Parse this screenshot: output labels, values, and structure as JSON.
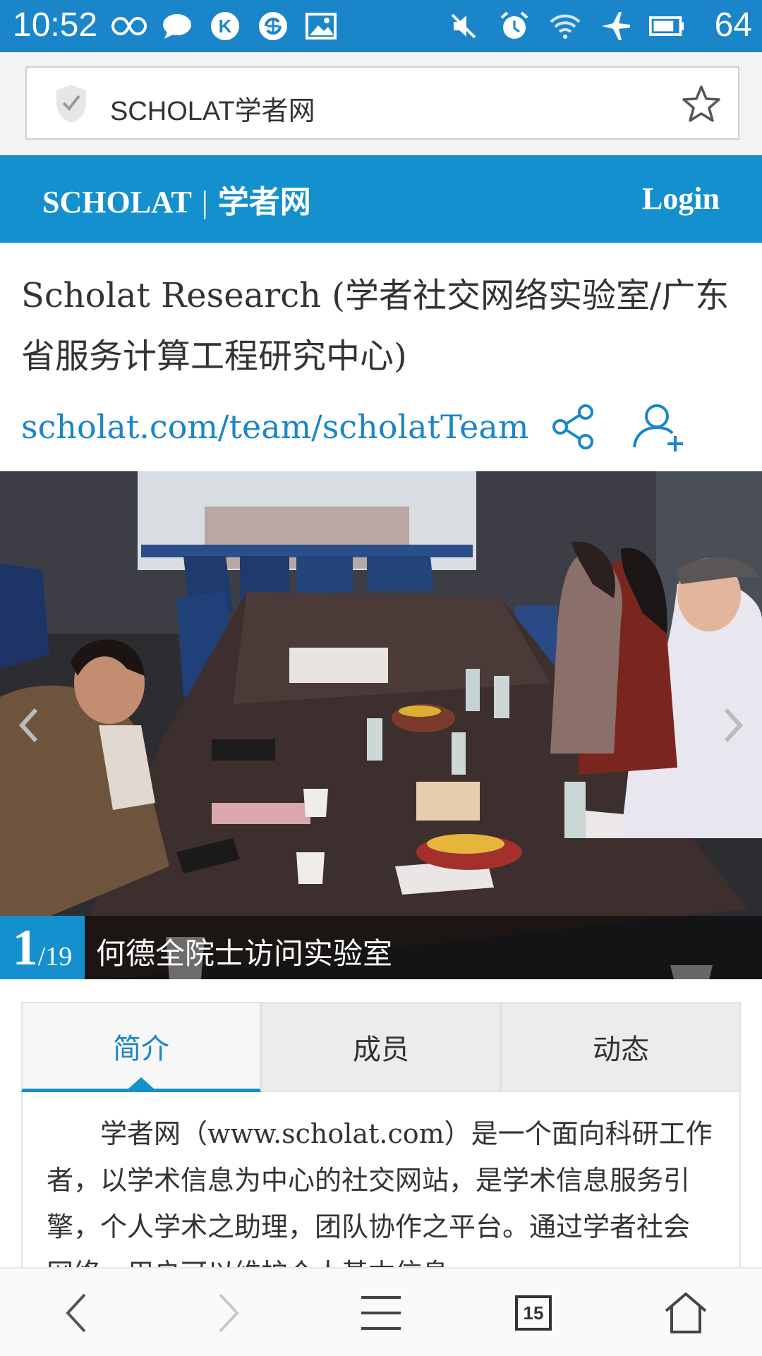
{
  "status_bar": {
    "time": "10:52",
    "battery_percent": "64",
    "icons_left": [
      "infinity-icon",
      "chat-icon",
      "k-icon",
      "sync-icon",
      "image-icon"
    ],
    "icons_right": [
      "mute-icon",
      "alarm-icon",
      "wifi-icon",
      "airplane-icon",
      "battery-icon"
    ]
  },
  "browser": {
    "address_text": "SCHOLAT学者网",
    "tab_count": "15"
  },
  "site_header": {
    "brand_en": "SCHOLAT",
    "brand_sep": "|",
    "brand_cn": "学者网",
    "login_label": "Login"
  },
  "team": {
    "title": "Scholat Research (学者社交网络实验室/广东省服务计算工程研究中心)",
    "url": "scholat.com/team/scholatTeam"
  },
  "carousel": {
    "current": "1",
    "total": "/19",
    "caption": "何德全院士访问实验室"
  },
  "tabs": [
    {
      "label": "简介"
    },
    {
      "label": "成员"
    },
    {
      "label": "动态"
    }
  ],
  "intro_text": "学者网（www.scholat.com）是一个面向科研工作者，以学术信息为中心的社交网站，是学术信息服务引擎，个人学术之助理，团队协作之平台。通过学者社会网络，用户可以维护个人基本信息",
  "colors": {
    "status_bar": "#1a86c9",
    "site_header": "#1490cf",
    "link": "#1a86c9"
  }
}
